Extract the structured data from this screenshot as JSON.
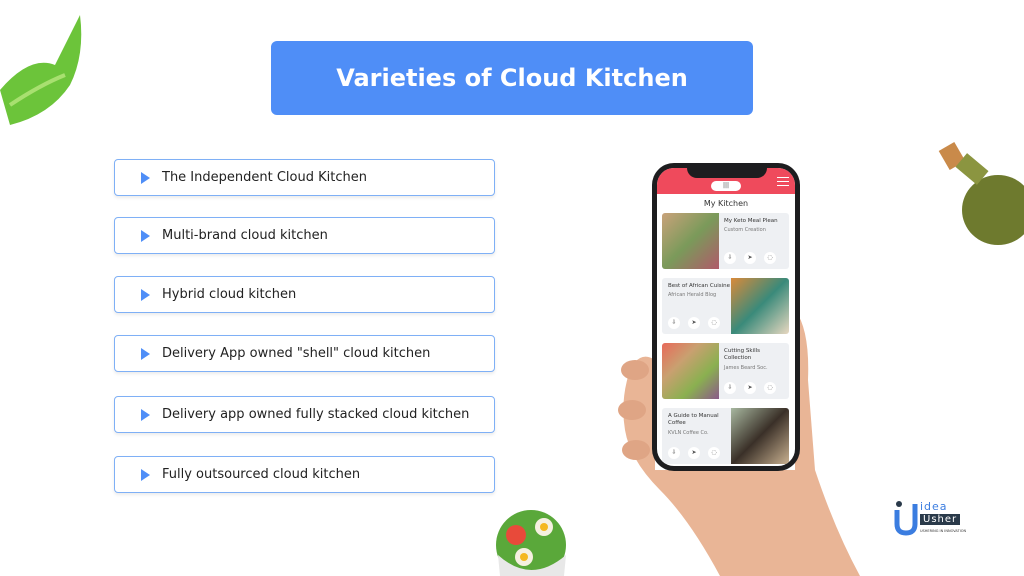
{
  "title": "Varieties of Cloud Kitchen",
  "items": [
    "The Independent Cloud Kitchen",
    "Multi-brand cloud kitchen",
    "Hybrid cloud kitchen",
    "Delivery App owned \"shell\" cloud kitchen",
    "Delivery app owned fully stacked cloud kitchen",
    "Fully outsourced cloud kitchen"
  ],
  "phone": {
    "screen_title": "My Kitchen",
    "cards": [
      {
        "title": "My Keto Meal Plean",
        "subtitle": "Custom Creation"
      },
      {
        "title": "Best of African Cuisine",
        "subtitle": "African Herald Blog"
      },
      {
        "title": "Cutting Skills Collection",
        "subtitle": "James Beard Soc."
      },
      {
        "title": "A Guide to Manual Coffee",
        "subtitle": "KVLN Coffee Co."
      }
    ]
  },
  "logo": {
    "text_top": "idea",
    "text_bottom": "Usher",
    "tagline": "USHERING IN INNOVATION"
  },
  "colors": {
    "accent": "#4f8ef7",
    "app_header": "#ef4a5c"
  }
}
